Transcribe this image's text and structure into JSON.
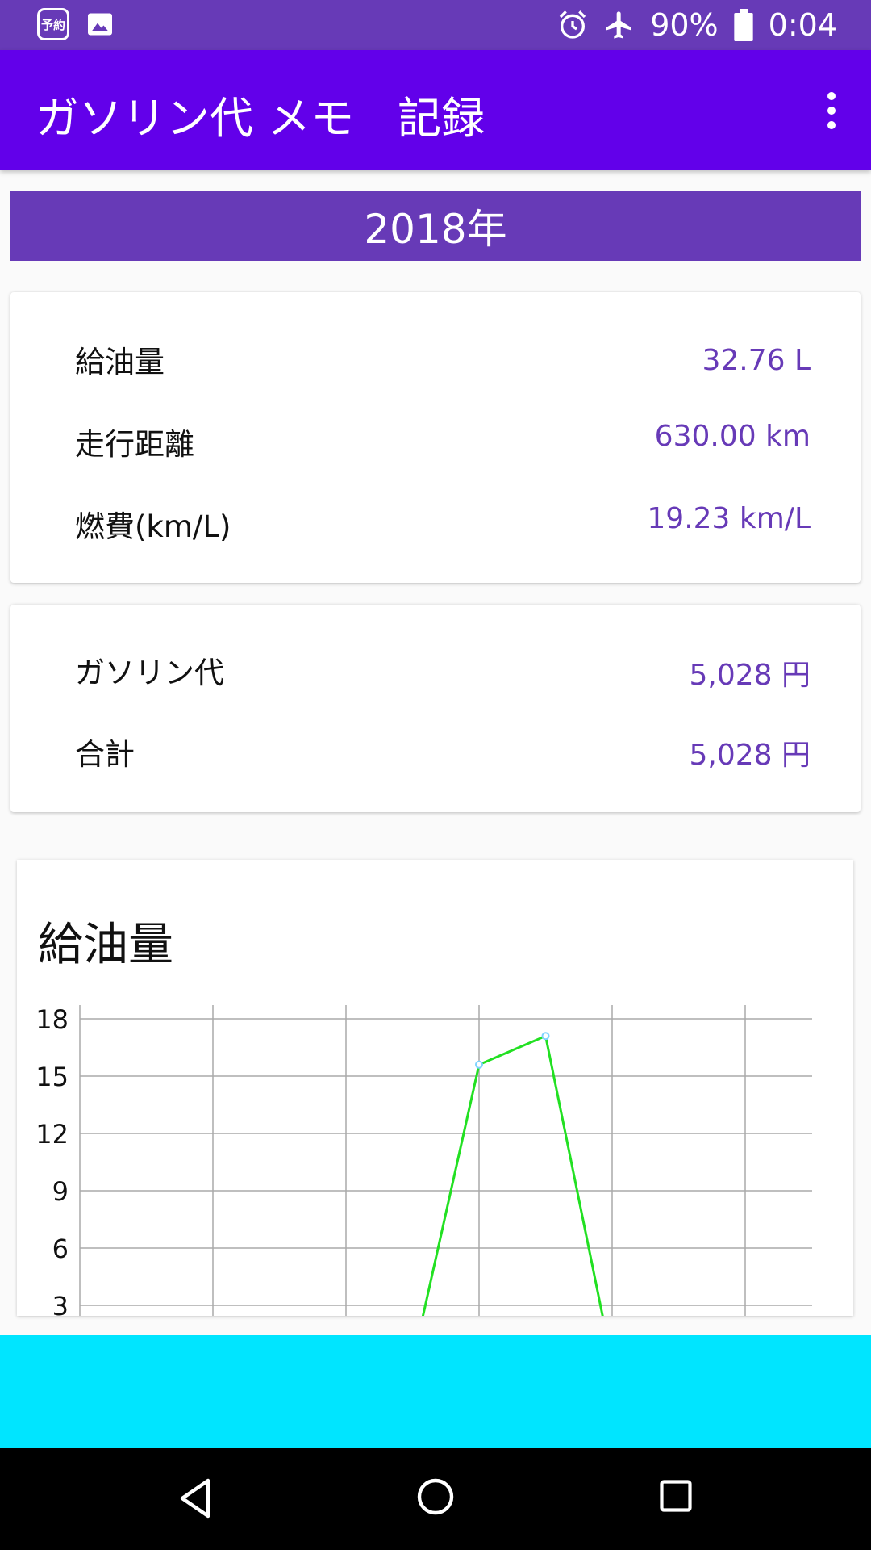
{
  "status_bar": {
    "left_badge": "予約",
    "icons": [
      "reservation-icon",
      "image-icon",
      "alarm-icon",
      "airplane-icon",
      "battery-icon"
    ],
    "battery": "90%",
    "time": "0:04"
  },
  "app_bar": {
    "title": "ガソリン代 メモ　記録",
    "menu_icon": "more-vert-icon"
  },
  "year": "2018年",
  "stats_card": {
    "rows": [
      {
        "label": "給油量",
        "value": "32.76 L"
      },
      {
        "label": "走行距離",
        "value": "630.00 km"
      },
      {
        "label": "燃費(km/L)",
        "value": "19.23 km/L"
      }
    ]
  },
  "cost_card": {
    "rows": [
      {
        "label": "ガソリン代",
        "value": "5,028 円"
      },
      {
        "label": "合計",
        "value": "5,028 円"
      }
    ]
  },
  "chart_data": {
    "type": "line",
    "title": "給油量",
    "xlabel": "",
    "ylabel": "",
    "y_ticks": [
      "18",
      "15",
      "12",
      "9",
      "6",
      "3"
    ],
    "ylim": [
      0,
      18
    ],
    "grid": true,
    "series": [
      {
        "values": [
          0,
          0,
          0,
          0,
          0,
          0,
          15.6,
          17.1,
          0
        ],
        "color": "#22e022"
      }
    ]
  },
  "colors": {
    "status_bar": "#673ab7",
    "app_bar": "#6200ea",
    "accent": "#673ab7",
    "ad_area": "#00e5ff"
  },
  "nav_bar": {
    "icons": [
      "back-icon",
      "home-icon",
      "recents-icon"
    ]
  }
}
